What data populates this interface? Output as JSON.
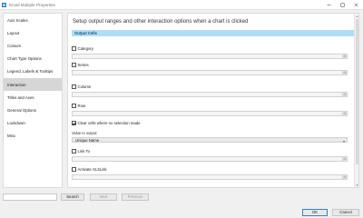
{
  "window": {
    "title": "Email Multiple Properties",
    "colors": {
      "accent": "#2b78c5",
      "section_bar": "#aedff7",
      "active_nav": "#d6d6d6"
    }
  },
  "sidebar": {
    "items": [
      {
        "label": "Axis Scales",
        "active": false
      },
      {
        "label": "Layout",
        "active": false
      },
      {
        "label": "Colours",
        "active": false
      },
      {
        "label": "Chart Type Options",
        "active": false
      },
      {
        "label": "Legend, Labels & Tooltips",
        "active": false
      },
      {
        "label": "Interaction",
        "active": true
      },
      {
        "label": "Titles and Axes",
        "active": false
      },
      {
        "label": "General Options",
        "active": false
      },
      {
        "label": "Lockdown",
        "active": false
      },
      {
        "label": "Misc",
        "active": false
      }
    ]
  },
  "main": {
    "header": "Setup output ranges and other interaction options when a chart is clicked",
    "section_title": "Output Cells",
    "options": {
      "category": {
        "label": "Category",
        "checked": false
      },
      "series": {
        "label": "Series",
        "checked": false
      },
      "column": {
        "label": "Column",
        "checked": false
      },
      "row": {
        "label": "Row",
        "checked": false
      },
      "clear_cells": {
        "label": "Clear cells where no selection made",
        "checked": true
      },
      "link_to": {
        "label": "Link To",
        "checked": false
      },
      "activate_xl3link": {
        "label": "Activate XL3Link",
        "checked": false
      }
    },
    "value_to_output": {
      "label": "Value to output:",
      "selected": "Unique Name"
    }
  },
  "footer": {
    "search_value": "",
    "search_button": "Search",
    "next_button": "Next",
    "previous_button": "Previous",
    "ok_button": "OK",
    "cancel_button": "Cancel"
  }
}
